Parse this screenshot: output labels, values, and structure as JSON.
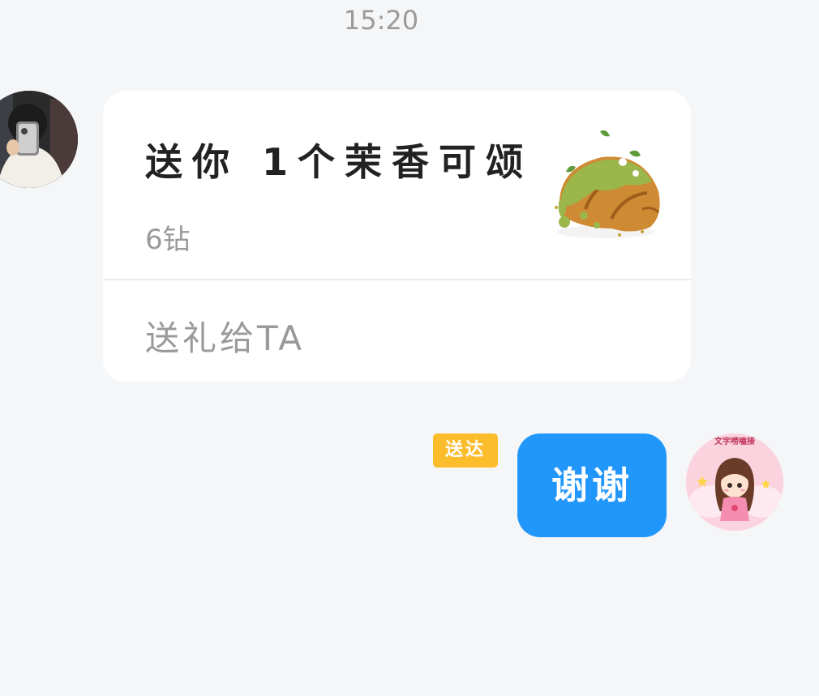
{
  "status": {
    "time": "15:20"
  },
  "incoming": {
    "avatar_icon": "user-avatar-photo",
    "gift": {
      "title": "送你 1个茉香可颂",
      "price": "6钻",
      "image_icon": "matcha-croissant-icon",
      "action_label": "送礼给TA"
    }
  },
  "outgoing": {
    "status_badge": "送达",
    "message": "谢谢",
    "avatar_icon": "cartoon-girl-avatar",
    "avatar_text": "文字唠嗑接"
  },
  "colors": {
    "background": "#f5f6f8",
    "bubble": "#2196fb",
    "badge": "#fbbd2c",
    "muted_text": "#9a9a9a",
    "title_text": "#222222"
  }
}
